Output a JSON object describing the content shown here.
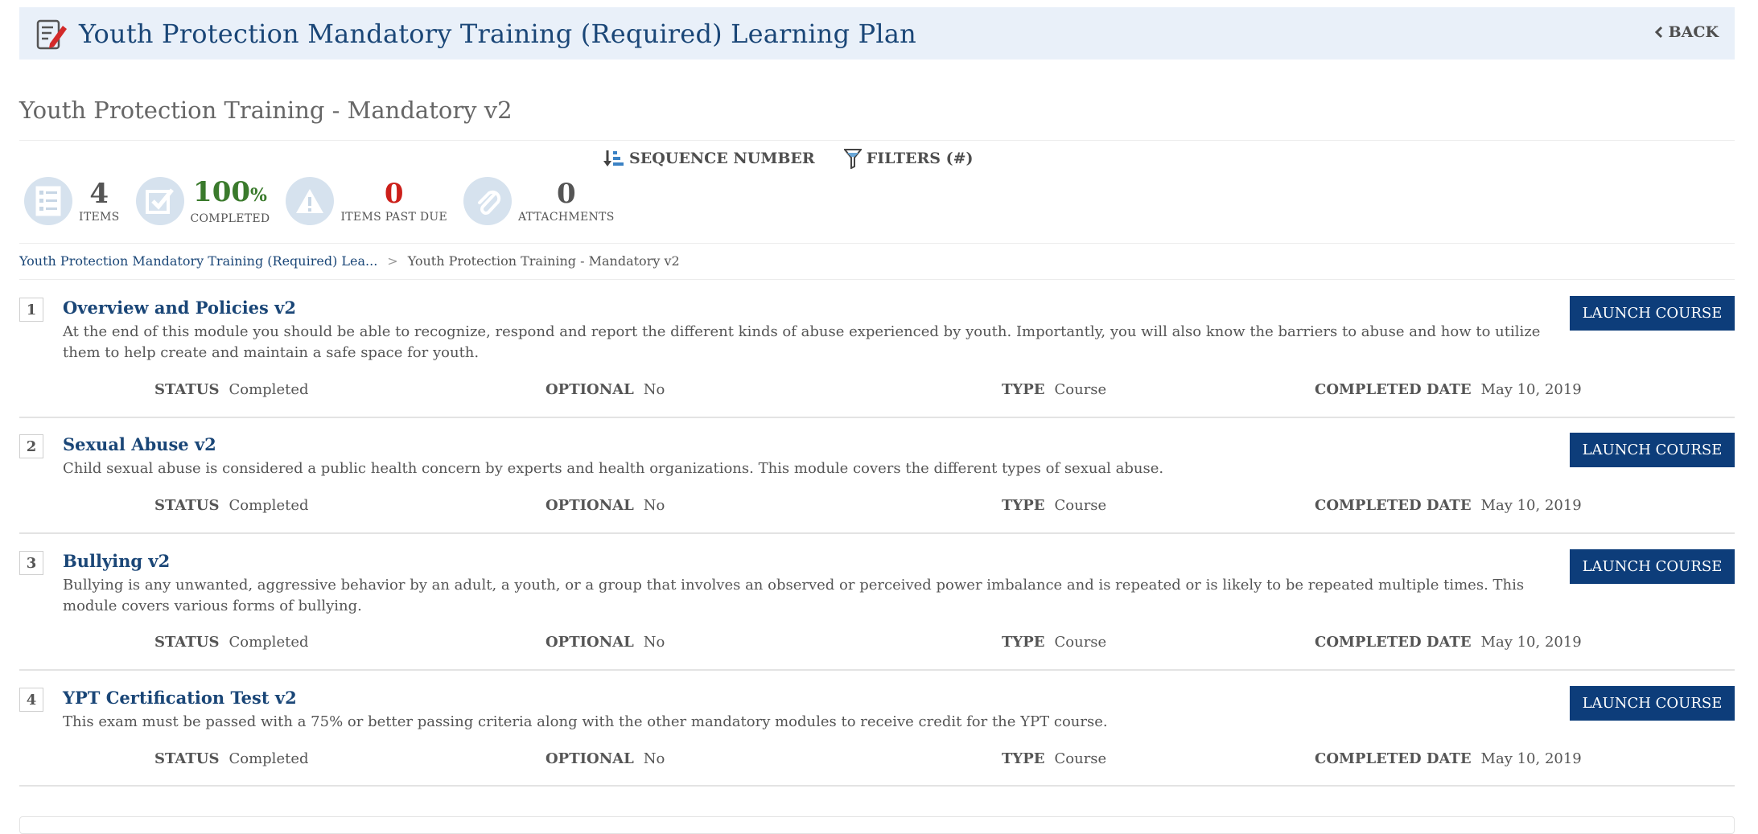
{
  "header": {
    "title": "Youth Protection Mandatory Training (Required) Learning Plan",
    "back_label": "BACK"
  },
  "plan_name": "Youth Protection Training - Mandatory v2",
  "tools": {
    "sort_label": "SEQUENCE NUMBER",
    "filters_label": "FILTERS (#)"
  },
  "stats": {
    "items": {
      "value": "4",
      "label": "ITEMS"
    },
    "completed": {
      "value": "100",
      "unit": "%",
      "label": "COMPLETED"
    },
    "past_due": {
      "value": "0",
      "label": "ITEMS PAST DUE"
    },
    "attachments": {
      "value": "0",
      "label": "ATTACHMENTS"
    }
  },
  "breadcrumb": {
    "parent": "Youth Protection Mandatory Training (Required) Lea...",
    "separator": ">",
    "current": "Youth Protection Training - Mandatory v2"
  },
  "meta_labels": {
    "status": "STATUS",
    "optional": "OPTIONAL",
    "type": "TYPE",
    "completed_date": "COMPLETED DATE"
  },
  "launch_label": "LAUNCH COURSE",
  "items": [
    {
      "number": "1",
      "title": "Overview and Policies v2",
      "description": "At the end of this module you should be able to recognize, respond and report the different kinds of abuse experienced by youth. Importantly, you will also know the barriers to abuse and how to utilize them to help create and maintain a safe space for youth.",
      "status": "Completed",
      "optional": "No",
      "type": "Course",
      "completed_date": "May 10, 2019"
    },
    {
      "number": "2",
      "title": "Sexual Abuse v2",
      "description": "Child sexual abuse is considered a public health concern by experts and health organizations. This module covers the different types of sexual abuse.",
      "status": "Completed",
      "optional": "No",
      "type": "Course",
      "completed_date": "May 10, 2019"
    },
    {
      "number": "3",
      "title": "Bullying v2",
      "description": "Bullying is any unwanted, aggressive behavior by an adult, a youth, or a group that involves an observed or perceived power imbalance and is repeated or is likely to be repeated multiple times. This module covers various forms of bullying.",
      "status": "Completed",
      "optional": "No",
      "type": "Course",
      "completed_date": "May 10, 2019"
    },
    {
      "number": "4",
      "title": "YPT Certification Test v2",
      "description": "This exam must be passed with a 75% or better passing criteria along with the other mandatory modules to receive credit for the YPT course.",
      "status": "Completed",
      "optional": "No",
      "type": "Course",
      "completed_date": "May 10, 2019"
    }
  ],
  "colors": {
    "brand_blue": "#1a4677",
    "button_blue": "#0d3d7a",
    "completed_green": "#3a7a2c",
    "past_due_red": "#cc1f1a",
    "header_bg": "#e9f0f9"
  }
}
